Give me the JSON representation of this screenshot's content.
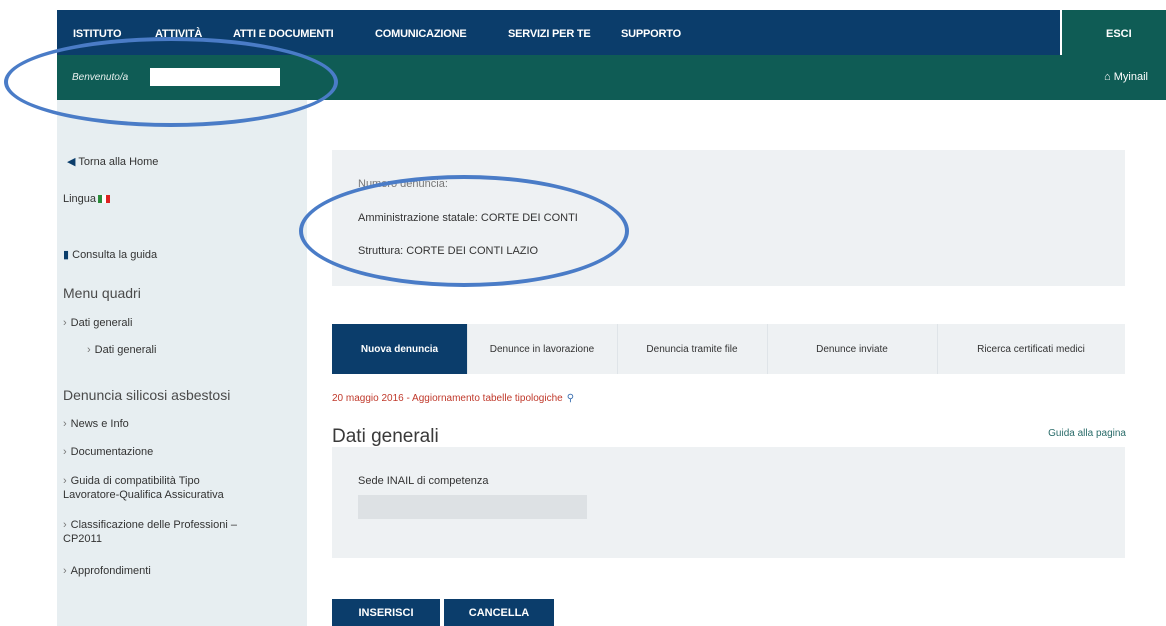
{
  "topnav": {
    "items": [
      "ISTITUTO",
      "ATTIVITÀ",
      "ATTI E DOCUMENTI",
      "COMUNICAZIONE",
      "SERVIZI PER TE",
      "SUPPORTO"
    ],
    "esci": "ESCI"
  },
  "welcome": {
    "label": "Benvenuto/a",
    "mylink": "Myinail"
  },
  "sidebar": {
    "home": "Torna alla Home",
    "lingua": "Lingua",
    "guida": "Consulta la guida",
    "menu_quadri": "Menu quadri",
    "dati_generali_1": "Dati generali",
    "dati_generali_2": "Dati generali",
    "section2": "Denuncia silicosi asbestosi",
    "news": "News e Info",
    "documentazione": "Documentazione",
    "compat_1": "Guida di compatibilità Tipo",
    "compat_2": "Lavoratore-Qualifica Assicurativa",
    "classif_1": "Classificazione delle Professioni –",
    "classif_2": "CP2011",
    "approfondimenti": "Approfondimenti"
  },
  "info": {
    "numero": "Numero denuncia:",
    "amministrazione": "Amministrazione statale: CORTE DEI CONTI",
    "struttura": "Struttura: CORTE DEI CONTI LAZIO"
  },
  "tabs": [
    "Nuova denuncia",
    "Denunce in lavorazione",
    "Denuncia tramite file",
    "Denunce inviate",
    "Ricerca certificati medici"
  ],
  "news_line": "20 maggio 2016 - Aggiornamento tabelle tipologiche",
  "page_title": "Dati generali",
  "guida_pagina": "Guida alla pagina",
  "form": {
    "sede_label": "Sede INAIL di competenza"
  },
  "buttons": {
    "inserisci": "INSERISCI",
    "cancella": "CANCELLA"
  },
  "colors": {
    "nav_blue": "#0b3d6b",
    "teal": "#0f5c55",
    "sidebar_bg": "#e7eef1",
    "oval_blue": "#4a7cc7",
    "news_red": "#c0392b"
  }
}
